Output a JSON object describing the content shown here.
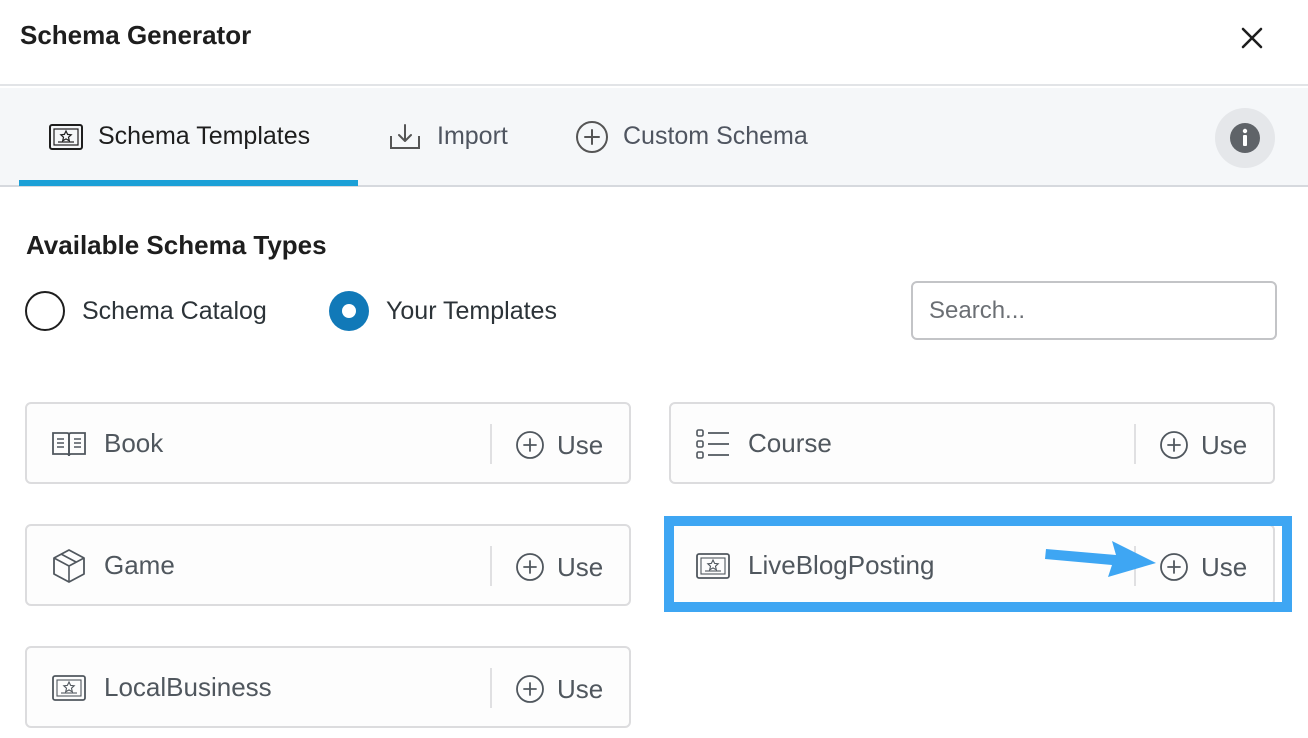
{
  "dialog": {
    "title": "Schema Generator",
    "close_icon": "close-icon"
  },
  "tabs": [
    {
      "label": "Schema Templates",
      "icon": "certificate-icon",
      "active": true
    },
    {
      "label": "Import",
      "icon": "import-icon",
      "active": false
    },
    {
      "label": "Custom Schema",
      "icon": "plus-circle-icon",
      "active": false
    }
  ],
  "info_icon": "info-icon",
  "section": {
    "title": "Available Schema Types",
    "radio_options": [
      {
        "label": "Schema Catalog",
        "checked": false
      },
      {
        "label": "Your Templates",
        "checked": true
      }
    ],
    "search": {
      "placeholder": "Search...",
      "value": ""
    }
  },
  "templates": [
    {
      "name": "Book",
      "icon": "book-icon",
      "use_label": "Use"
    },
    {
      "name": "Course",
      "icon": "list-icon",
      "use_label": "Use"
    },
    {
      "name": "Game",
      "icon": "cube-icon",
      "use_label": "Use"
    },
    {
      "name": "LiveBlogPosting",
      "icon": "certificate-icon",
      "use_label": "Use",
      "highlighted": true
    },
    {
      "name": "LocalBusiness",
      "icon": "certificate-icon",
      "use_label": "Use"
    }
  ],
  "colors": {
    "accent": "#1ba0d7",
    "radio_checked": "#1179b8",
    "highlight": "#3ea6f3"
  }
}
